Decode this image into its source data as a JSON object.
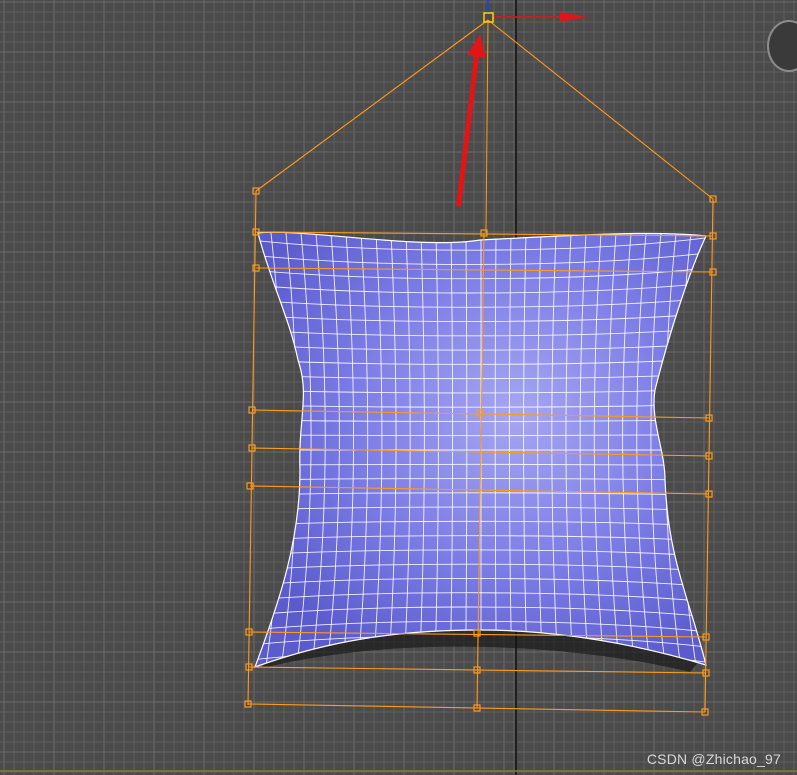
{
  "viewport": {
    "background": "#4b4b4b",
    "grid_color": "#5f5f5f",
    "grid_major_color": "#6b6b6b",
    "grid_axis_color": "#222222"
  },
  "pillow": {
    "fill": "#7070e0",
    "highlight": "#a6a6f2",
    "wire_color": "#ffffff"
  },
  "lattice": {
    "color": "#ff9a1a"
  },
  "gizmo": {
    "x_axis_color": "#e0141b",
    "y_axis_color": "#1a3cff"
  },
  "annotation": {
    "arrow_color": "#e01515"
  },
  "watermark": "CSDN @Zhichao_97"
}
